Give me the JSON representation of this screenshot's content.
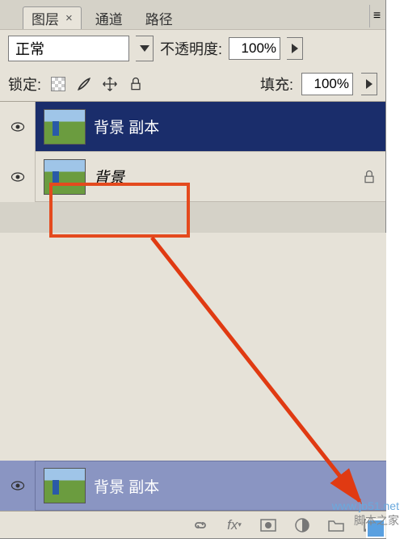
{
  "tabs": {
    "layers": "图层",
    "channels": "通道",
    "paths": "路径"
  },
  "blend": {
    "mode": "正常",
    "opacity_label": "不透明度:",
    "opacity_value": "100%"
  },
  "lock": {
    "label": "锁定:",
    "fill_label": "填充:",
    "fill_value": "100%"
  },
  "layers": [
    {
      "name": "背景 副本",
      "selected": true,
      "locked": false
    },
    {
      "name": "背景",
      "selected": false,
      "locked": true
    }
  ],
  "bottom_layer": {
    "name": "背景 副本"
  },
  "watermark": {
    "url": "www.jb51.net",
    "site": "脚本之家"
  }
}
